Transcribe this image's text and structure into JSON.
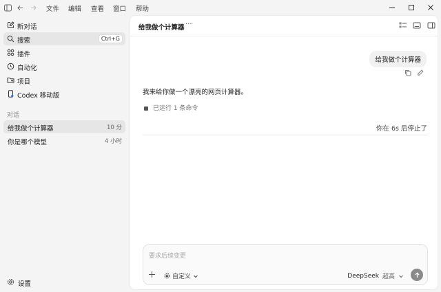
{
  "menu": [
    "文件",
    "编辑",
    "查看",
    "窗口",
    "帮助"
  ],
  "sidebar": {
    "nav": [
      {
        "label": "新对话",
        "icon": "new-chat-icon"
      },
      {
        "label": "搜索",
        "icon": "search-icon",
        "shortcut": "Ctrl+G"
      },
      {
        "label": "插件",
        "icon": "plugins-icon"
      },
      {
        "label": "自动化",
        "icon": "clock-icon"
      },
      {
        "label": "项目",
        "icon": "folder-icon"
      },
      {
        "label": "Codex 移动版",
        "icon": "mobile-icon"
      }
    ],
    "section_label": "对话",
    "conversations": [
      {
        "title": "给我做个计算器",
        "time": "10 分"
      },
      {
        "title": "你是哪个模型",
        "time": "4 小时"
      }
    ],
    "settings_label": "设置"
  },
  "main": {
    "title": "给我做个计算器",
    "more": "···",
    "user_message": "给我做个计算器",
    "assistant_message": "我来给你做一个漂亮的网页计算器。",
    "ran_command": "已运行 1 条命令",
    "stopped": "你在 6s 后停止了"
  },
  "composer": {
    "placeholder": "要求后续变更",
    "custom_label": "自定义",
    "model": "DeepSeek",
    "level": "超高"
  },
  "colors": {
    "accent_send": "#8a8a8a",
    "sidebar_bg": "#f4f4f4",
    "active_bg": "#e6e6e6"
  }
}
